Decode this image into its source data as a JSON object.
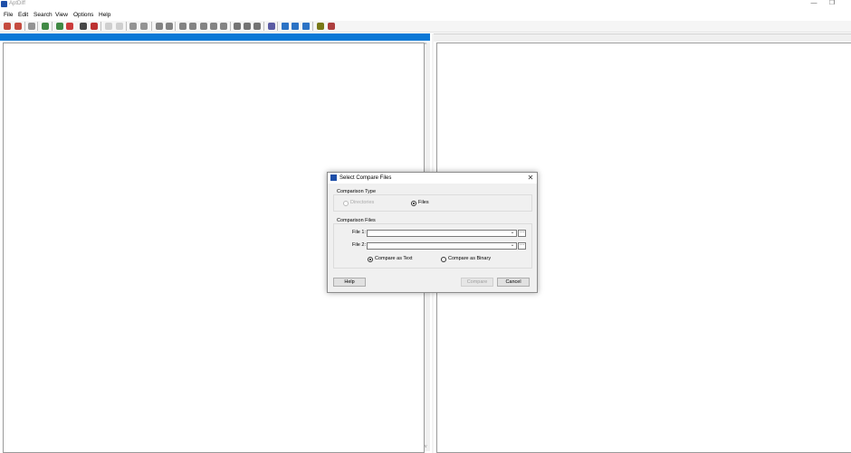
{
  "window": {
    "title": "AptDiff",
    "minimize_glyph": "—",
    "restore_glyph": "❐"
  },
  "menu": [
    {
      "label": "File"
    },
    {
      "label": "Edit"
    },
    {
      "label": "Search"
    },
    {
      "label": "View"
    },
    {
      "label": "Options"
    },
    {
      "label": "Help"
    }
  ],
  "toolbar": {
    "icons": [
      "next-diff-icon",
      "prev-diff-icon",
      "find-icon",
      "refresh-icon",
      "mark-green-icon",
      "mark-red-icon",
      "bug-icon",
      "bug-red-icon",
      "undo-icon",
      "redo-icon",
      "align-left-icon",
      "align-right-icon",
      "arrow-left-icon",
      "arrow-right-icon",
      "first-icon",
      "up-icon",
      "center-icon",
      "down-icon",
      "last-icon",
      "save-icon",
      "save-all-icon",
      "copy-icon",
      "print-icon",
      "layout-horizontal-icon",
      "layout-vertical-icon",
      "layout-grid-icon",
      "help-icon",
      "stop-icon"
    ]
  },
  "dialog": {
    "title": "Select Compare Files",
    "close_glyph": "✕",
    "comparison_type_label": "Comparison Type",
    "option_directories": "Directories",
    "option_files": "Files",
    "comparison_files_label": "Comparison Files",
    "file1_label": "File 1:",
    "file1_value": "",
    "file2_label": "File 2:",
    "file2_value": "",
    "browse_glyph": "···",
    "compare_as_text": "Compare as Text",
    "compare_as_binary": "Compare as Binary",
    "help_button": "Help",
    "compare_button": "Compare",
    "cancel_button": "Cancel"
  },
  "colors": {
    "accent": "#0a78d6",
    "app_icon": "#1e4fa8"
  }
}
